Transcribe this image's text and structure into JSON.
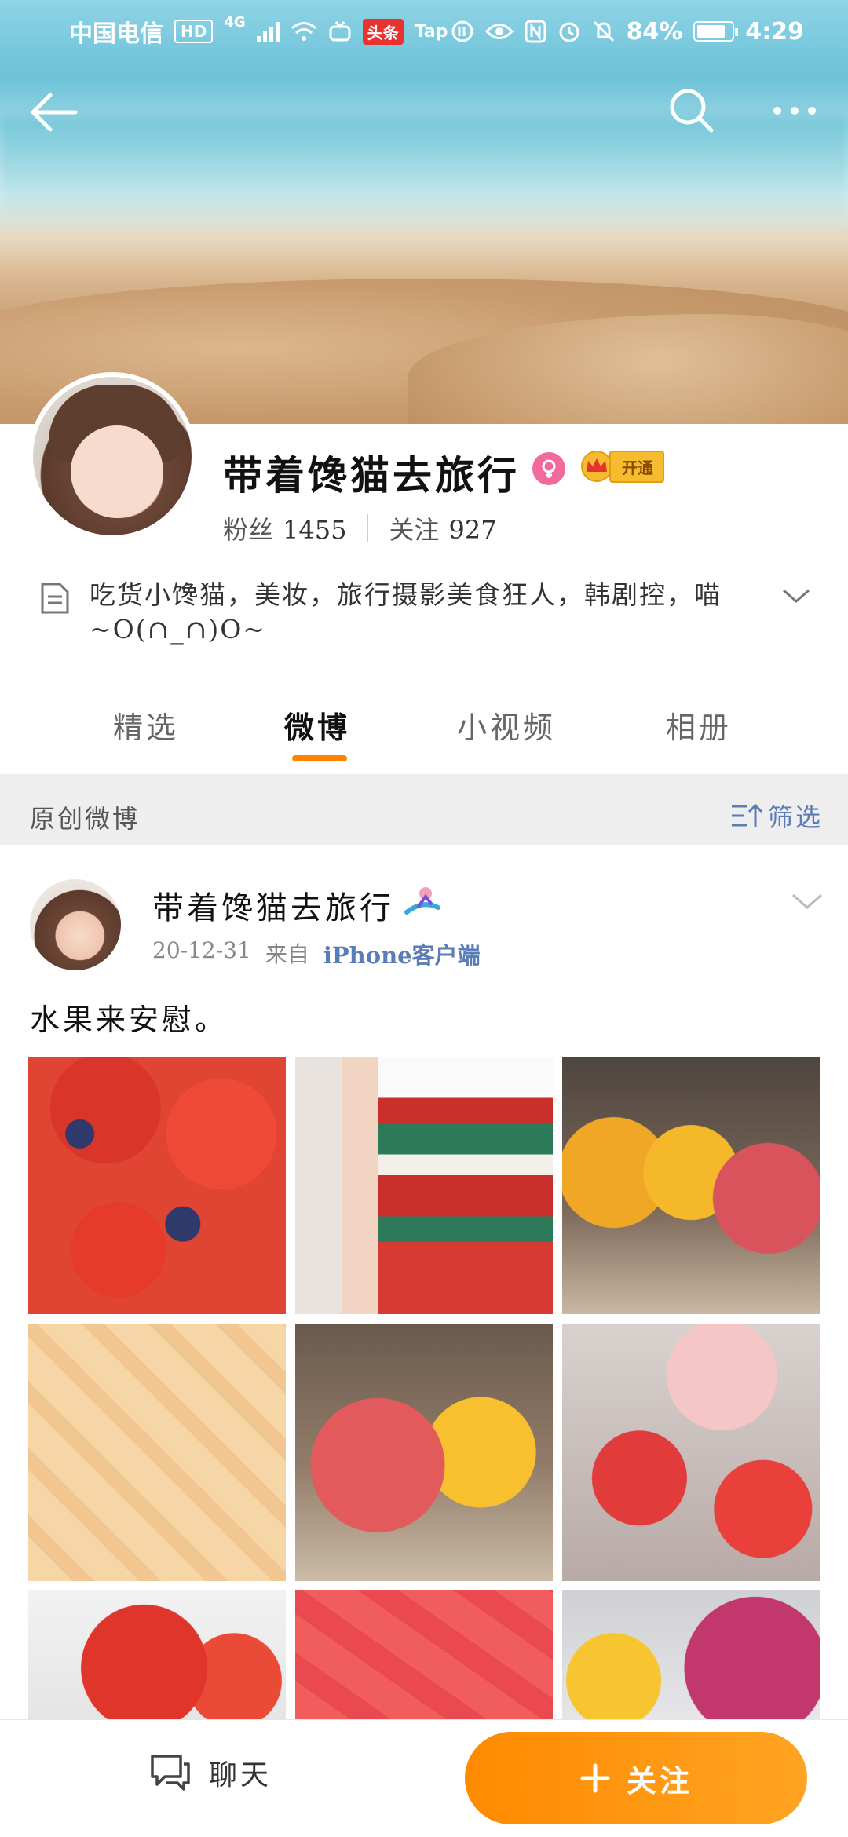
{
  "status_bar": {
    "carrier": "中国电信",
    "hd_label": "HD",
    "network_label": "4G",
    "toutiao_label": "头条",
    "tap_label": "Tap",
    "battery_text": "84%",
    "time": "4:29",
    "battery_level": 0.84
  },
  "profile": {
    "name": "带着馋猫去旅行",
    "vip_label": "开通",
    "followers_label": "粉丝",
    "followers_count": "1455",
    "following_label": "关注",
    "following_count": "927",
    "bio": "吃货小馋猫，美妆，旅行摄影美食狂人，韩剧控，喵~O(∩_∩)O~"
  },
  "tabs": [
    {
      "label": "精选",
      "active": false
    },
    {
      "label": "微博",
      "active": true
    },
    {
      "label": "小视频",
      "active": false
    },
    {
      "label": "相册",
      "active": false
    }
  ],
  "filter_bar": {
    "title": "原创微博",
    "filter_label": "筛选"
  },
  "post": {
    "author": "带着馋猫去旅行",
    "date": "20-12-31",
    "from_label": "来自",
    "source": "iPhone客户端",
    "text": "水果来安慰。",
    "photos": [
      {
        "name": "strawberry-blueberry-photo"
      },
      {
        "name": "christmas-cup-photo"
      },
      {
        "name": "mango-dessert-photo"
      },
      {
        "name": "cantaloupe-photo"
      },
      {
        "name": "red-cake-photo"
      },
      {
        "name": "strawberry-icecream-photo"
      },
      {
        "name": "strawberry-photo"
      },
      {
        "name": "watermelon-photo"
      },
      {
        "name": "dragonfruit-photo"
      }
    ]
  },
  "bottom_bar": {
    "chat_label": "聊天",
    "follow_label": "关注"
  },
  "colors": {
    "accent_orange": "#ff8200",
    "link_blue": "#5a7cb7",
    "gender_pink": "#f06b9b"
  }
}
